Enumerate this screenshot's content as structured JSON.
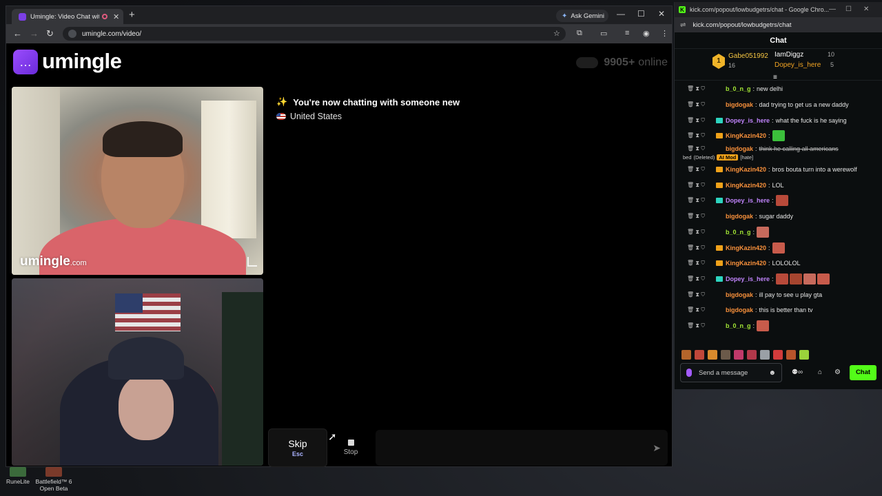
{
  "left_browser": {
    "tab_title": "Umingle: Video Chat with S",
    "ask_gemini": "Ask Gemini",
    "url": "umingle.com/video/"
  },
  "site": {
    "logo_text": "umingle",
    "online_count": "9905+",
    "online_label": "online",
    "video_watermark": "umingle",
    "video_watermark_suffix": ".com",
    "status_line": "You're now chatting with someone new",
    "status_country": "United States",
    "skip_label": "Skip",
    "skip_key": "Esc",
    "stop_label": "Stop"
  },
  "right_browser": {
    "window_title": "kick.com/popout/lowbudgetrs/chat - Google Chro...",
    "url": "kick.com/popout/lowbudgetrs/chat",
    "chat_header": "Chat",
    "leaderboard": [
      {
        "rank": "1",
        "name": "Gabe051992",
        "count": "16"
      },
      {
        "name": "IamDiggz",
        "count": "10"
      },
      {
        "name": "Dopey_is_here",
        "count": "5"
      }
    ],
    "messages": [
      {
        "user": "b_0_n_g",
        "text": "new delhi",
        "color": "#a3e635"
      },
      {
        "user": "bigdogak",
        "text": "dad trying to get us a new daddy",
        "color": "#fb923c"
      },
      {
        "user": "Dopey_is_here",
        "text": "what the fuck is he saying",
        "color": "#c084fc"
      },
      {
        "user": "KingKazin420",
        "text": "",
        "color": "#fb923c"
      },
      {
        "user": "bigdogak",
        "text": "think he calling all americans",
        "color": "#fb923c"
      },
      {
        "user": "KingKazin420",
        "text": "bros bouta turn into a werewolf",
        "color": "#fb923c"
      },
      {
        "user": "KingKazin420",
        "text": "LOL",
        "color": "#fb923c"
      },
      {
        "user": "Dopey_is_here",
        "text": "",
        "color": "#c084fc"
      },
      {
        "user": "bigdogak",
        "text": "sugar daddy",
        "color": "#fb923c"
      },
      {
        "user": "b_0_n_g",
        "text": "",
        "color": "#a3e635"
      },
      {
        "user": "KingKazin420",
        "text": "",
        "color": "#fb923c"
      },
      {
        "user": "KingKazin420",
        "text": "LOLOLOL",
        "color": "#fb923c"
      },
      {
        "user": "Dopey_is_here",
        "text": "",
        "color": "#c084fc"
      },
      {
        "user": "bigdogak",
        "text": "ill pay to see u play gta",
        "color": "#fb923c"
      },
      {
        "user": "bigdogak",
        "text": "this is better than tv",
        "color": "#fb923c"
      },
      {
        "user": "b_0_n_g",
        "text": "",
        "color": "#a3e635"
      }
    ],
    "deleted_line": {
      "prefix": "bed",
      "deleted": "(Deleted)",
      "ai_mod": "AI Mod",
      "reason": "[hate]"
    },
    "send_placeholder": "Send a message",
    "chat_button": "Chat"
  },
  "taskbar": [
    {
      "label": "RuneLite"
    },
    {
      "label": "Battlefield™ 6 Open Beta"
    }
  ],
  "colors": {
    "kick_green": "#53fc18",
    "umingle_purple": "#8b3ff0"
  }
}
